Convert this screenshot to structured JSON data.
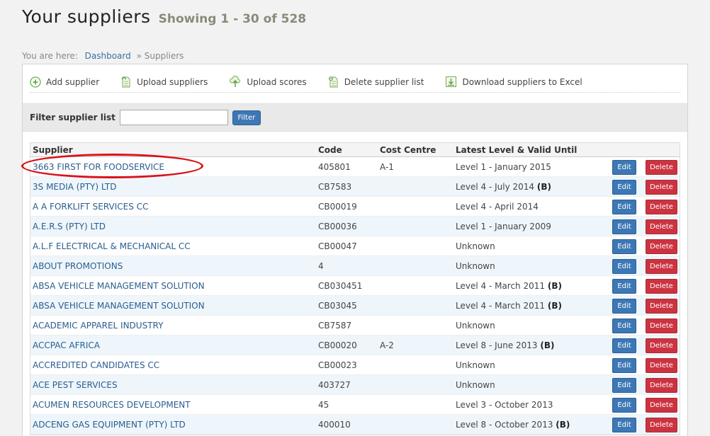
{
  "header": {
    "title": "Your suppliers",
    "showing": "Showing 1 - 30 of 528"
  },
  "breadcrumb": {
    "prefix": "You are here:",
    "home": "Dashboard",
    "current": "» Suppliers"
  },
  "toolbar": {
    "add": "Add supplier",
    "upload": "Upload suppliers",
    "scores": "Upload scores",
    "delete_list": "Delete supplier list",
    "download": "Download suppliers to Excel"
  },
  "filter": {
    "label": "Filter supplier list",
    "value": "",
    "button": "Filter"
  },
  "columns": {
    "supplier": "Supplier",
    "code": "Code",
    "cost_centre": "Cost Centre",
    "level": "Latest Level & Valid Until"
  },
  "buttons": {
    "edit": "Edit",
    "delete": "Delete"
  },
  "rows": [
    {
      "supplier": "3663 FIRST FOR FOODSERVICE",
      "code": "405801",
      "cost_centre": "A-1",
      "level": "Level 1 - January 2015",
      "flag": ""
    },
    {
      "supplier": "3S MEDIA (PTY) LTD",
      "code": "CB7583",
      "cost_centre": "",
      "level": "Level 4 - July 2014",
      "flag": "(B)"
    },
    {
      "supplier": "A A FORKLIFT SERVICES CC",
      "code": "CB00019",
      "cost_centre": "",
      "level": "Level 4 - April 2014",
      "flag": ""
    },
    {
      "supplier": "A.E.R.S (PTY) LTD",
      "code": "CB00036",
      "cost_centre": "",
      "level": "Level 1 - January 2009",
      "flag": ""
    },
    {
      "supplier": "A.L.F ELECTRICAL & MECHANICAL CC",
      "code": "CB00047",
      "cost_centre": "",
      "level": "Unknown",
      "flag": ""
    },
    {
      "supplier": "ABOUT PROMOTIONS",
      "code": "4",
      "cost_centre": "",
      "level": "Unknown",
      "flag": ""
    },
    {
      "supplier": "ABSA VEHICLE MANAGEMENT SOLUTION",
      "code": "CB030451",
      "cost_centre": "",
      "level": "Level 4 - March 2011",
      "flag": "(B)"
    },
    {
      "supplier": "ABSA VEHICLE MANAGEMENT SOLUTION",
      "code": "CB03045",
      "cost_centre": "",
      "level": "Level 4 - March 2011",
      "flag": "(B)"
    },
    {
      "supplier": "ACADEMIC APPAREL INDUSTRY",
      "code": "CB7587",
      "cost_centre": "",
      "level": "Unknown",
      "flag": ""
    },
    {
      "supplier": "ACCPAC AFRICA",
      "code": "CB00020",
      "cost_centre": "A-2",
      "level": "Level 8 - June 2013",
      "flag": "(B)"
    },
    {
      "supplier": "ACCREDITED CANDIDATES CC",
      "code": "CB00023",
      "cost_centre": "",
      "level": "Unknown",
      "flag": ""
    },
    {
      "supplier": "ACE PEST SERVICES",
      "code": "403727",
      "cost_centre": "",
      "level": "Unknown",
      "flag": ""
    },
    {
      "supplier": "ACUMEN RESOURCES DEVELOPMENT",
      "code": "45",
      "cost_centre": "",
      "level": "Level 3 - October 2013",
      "flag": ""
    },
    {
      "supplier": "ADCENG GAS EQUIPMENT (PTY) LTD",
      "code": "400010",
      "cost_centre": "",
      "level": "Level 8 - October 2013",
      "flag": "(B)"
    }
  ]
}
